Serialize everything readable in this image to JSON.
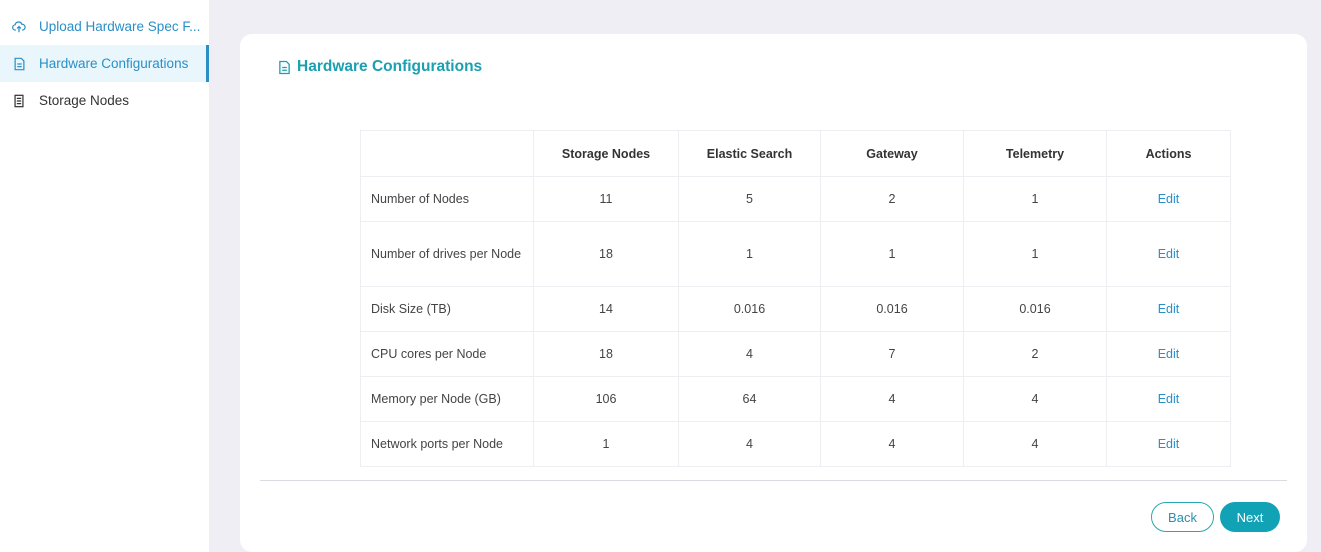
{
  "sidebar": {
    "items": [
      {
        "label": "Upload Hardware Spec F...",
        "icon": "upload-cloud-icon"
      },
      {
        "label": "Hardware Configurations",
        "icon": "document-icon"
      },
      {
        "label": "Storage Nodes",
        "icon": "server-icon"
      }
    ]
  },
  "card": {
    "title": "Hardware Configurations",
    "title_icon": "document-icon"
  },
  "table": {
    "headers": [
      "",
      "Storage Nodes",
      "Elastic Search",
      "Gateway",
      "Telemetry",
      "Actions"
    ],
    "rows": [
      {
        "label": "Number of Nodes",
        "values": [
          "11",
          "5",
          "2",
          "1"
        ],
        "action": "Edit"
      },
      {
        "label": "Number of drives per Node",
        "values": [
          "18",
          "1",
          "1",
          "1"
        ],
        "action": "Edit"
      },
      {
        "label": "Disk Size (TB)",
        "values": [
          "14",
          "0.016",
          "0.016",
          "0.016"
        ],
        "action": "Edit"
      },
      {
        "label": "CPU cores per Node",
        "values": [
          "18",
          "4",
          "7",
          "2"
        ],
        "action": "Edit"
      },
      {
        "label": "Memory per Node (GB)",
        "values": [
          "106",
          "64",
          "4",
          "4"
        ],
        "action": "Edit"
      },
      {
        "label": "Network ports per Node",
        "values": [
          "1",
          "4",
          "4",
          "4"
        ],
        "action": "Edit"
      }
    ]
  },
  "buttons": {
    "back": "Back",
    "next": "Next"
  },
  "colors": {
    "accent": "#2a8fc7",
    "title": "#1aa0b0",
    "primary_button": "#12a2b6"
  }
}
